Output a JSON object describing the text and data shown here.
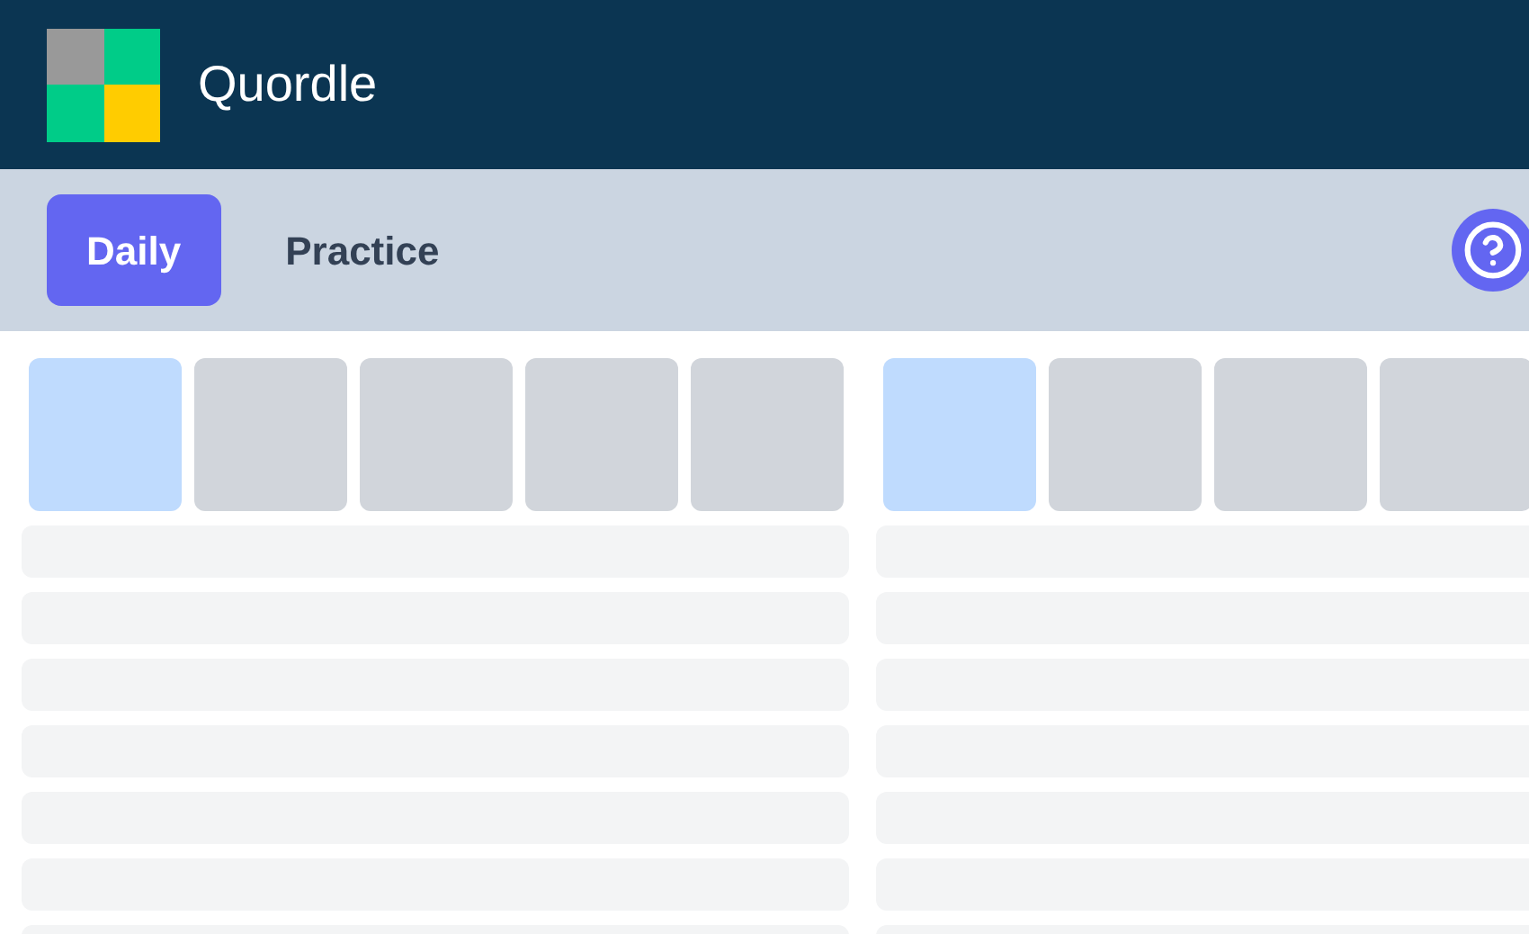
{
  "header": {
    "title": "Quordle"
  },
  "tabs": [
    {
      "label": "Daily",
      "selected": true
    },
    {
      "label": "Practice",
      "selected": false
    }
  ],
  "boards": [
    {
      "tiles": [
        {
          "selected": true
        },
        {
          "selected": false
        },
        {
          "selected": false
        },
        {
          "selected": false
        },
        {
          "selected": false
        }
      ],
      "guess_rows": [
        {
          "kind": "empty"
        },
        {
          "kind": "empty"
        },
        {
          "kind": "empty"
        },
        {
          "kind": "empty"
        },
        {
          "kind": "empty"
        },
        {
          "kind": "empty"
        },
        {
          "kind": "empty"
        }
      ]
    },
    {
      "tiles": [
        {
          "selected": true
        },
        {
          "selected": false
        },
        {
          "selected": false
        },
        {
          "selected": false
        }
      ],
      "guess_rows": [
        {
          "kind": "empty"
        },
        {
          "kind": "empty"
        },
        {
          "kind": "empty"
        },
        {
          "kind": "empty"
        },
        {
          "kind": "empty"
        },
        {
          "kind": "empty"
        },
        {
          "kind": "empty"
        }
      ]
    }
  ]
}
